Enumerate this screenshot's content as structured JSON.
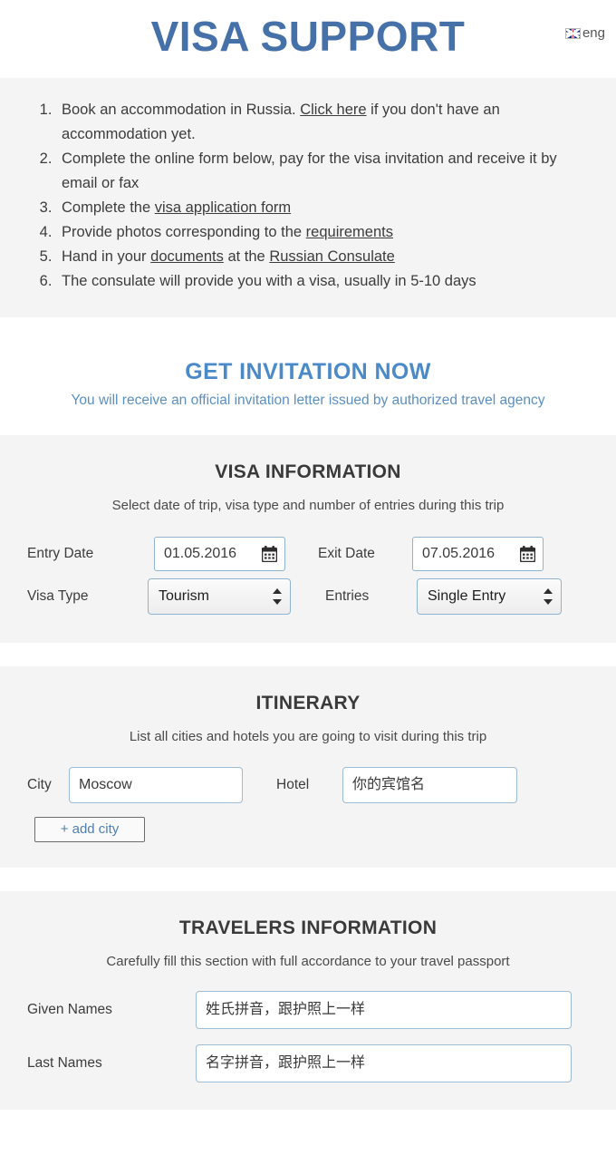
{
  "header": {
    "title": "VISA SUPPORT",
    "language": {
      "code": "eng",
      "flag_icon": "uk-flag-icon"
    },
    "accent_color": "#4571a8"
  },
  "steps": {
    "items": [
      {
        "number": "1.",
        "parts": [
          {
            "text": "Book an accommodation in Russia. ",
            "link": false
          },
          {
            "text": "Click here",
            "link": true
          },
          {
            "text": " if you don't have an accommodation yet.",
            "link": false
          }
        ]
      },
      {
        "number": "2.",
        "parts": [
          {
            "text": "Complete the online form below, pay for the visa invitation and receive it by email or fax",
            "link": false
          }
        ]
      },
      {
        "number": "3.",
        "parts": [
          {
            "text": "Complete the ",
            "link": false
          },
          {
            "text": "visa application form",
            "link": true
          }
        ]
      },
      {
        "number": "4.",
        "parts": [
          {
            "text": "Provide photos corresponding to the ",
            "link": false
          },
          {
            "text": "requirements",
            "link": true
          }
        ]
      },
      {
        "number": "5.",
        "parts": [
          {
            "text": "Hand in your ",
            "link": false
          },
          {
            "text": "documents",
            "link": true
          },
          {
            "text": " at the ",
            "link": false
          },
          {
            "text": "Russian Consulate",
            "link": true
          }
        ]
      },
      {
        "number": "6.",
        "parts": [
          {
            "text": "The consulate will provide you with a visa, usually in 5-10 days",
            "link": false
          }
        ]
      }
    ]
  },
  "invitation": {
    "title": "GET INVITATION NOW",
    "subtitle": "You will receive an official invitation letter issued by authorized travel agency",
    "title_color": "#4b8ac9",
    "subtitle_color": "#5b8fc2"
  },
  "visa_information": {
    "title": "VISA INFORMATION",
    "subtitle": "Select date of trip, visa type and number of entries during this trip",
    "entry_date": {
      "label": "Entry Date",
      "value": "01.05.2016",
      "icon": "calendar-icon"
    },
    "exit_date": {
      "label": "Exit Date",
      "value": "07.05.2016",
      "icon": "calendar-icon"
    },
    "visa_type": {
      "label": "Visa Type",
      "value": "Tourism"
    },
    "entries": {
      "label": "Entries",
      "value": "Single Entry"
    }
  },
  "itinerary": {
    "title": "ITINERARY",
    "subtitle": "List all cities and hotels you are going to visit during this trip",
    "city": {
      "label": "City",
      "value": "Moscow"
    },
    "hotel": {
      "label": "Hotel",
      "value": "你的宾馆名"
    },
    "add_city_label": "+ add city"
  },
  "travelers_information": {
    "title": "TRAVELERS INFORMATION",
    "subtitle": "Carefully fill this section with full accordance to your travel passport",
    "given_names": {
      "label": "Given Names",
      "value": "姓氏拼音，跟护照上一样"
    },
    "last_names": {
      "label": "Last Names",
      "value": "名字拼音，跟护照上一样"
    }
  }
}
